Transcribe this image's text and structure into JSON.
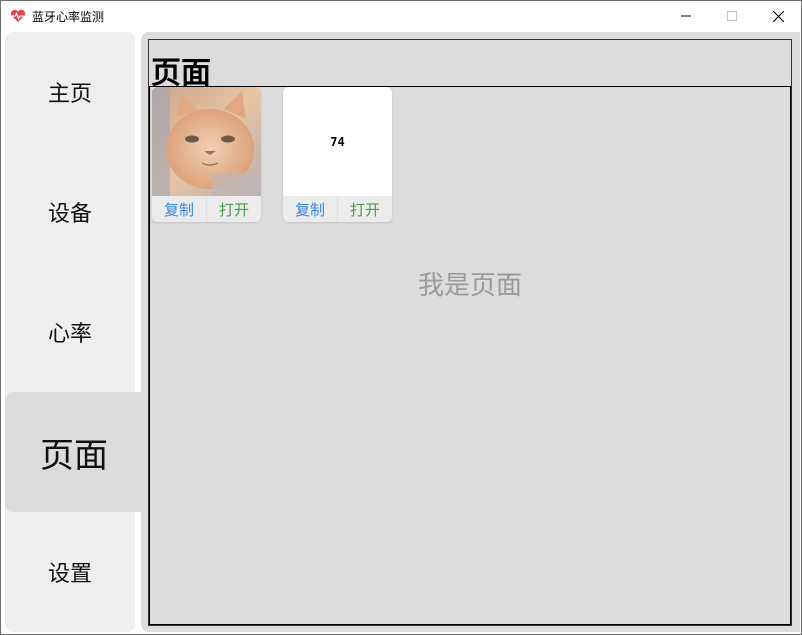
{
  "window": {
    "title": "蓝牙心率监测",
    "app_icon": "heart-icon",
    "controls": [
      "minimize-icon",
      "maximize-icon",
      "close-icon"
    ]
  },
  "sidebar": {
    "items": [
      {
        "label": "主页"
      },
      {
        "label": "设备"
      },
      {
        "label": "心率"
      },
      {
        "label": "页面",
        "active": true
      },
      {
        "label": "设置"
      }
    ]
  },
  "page": {
    "title": "页面",
    "placeholder": "我是页面",
    "cards": [
      {
        "thumb": "cat-photo",
        "copy_label": "复制",
        "open_label": "打开"
      },
      {
        "thumb_text": "74",
        "copy_label": "复制",
        "open_label": "打开"
      }
    ]
  },
  "colors": {
    "copy_action": "#3b86d8",
    "open_action": "#4a9b4a",
    "sidebar_bg": "#efefef",
    "panel_bg": "#dcdcdc"
  }
}
